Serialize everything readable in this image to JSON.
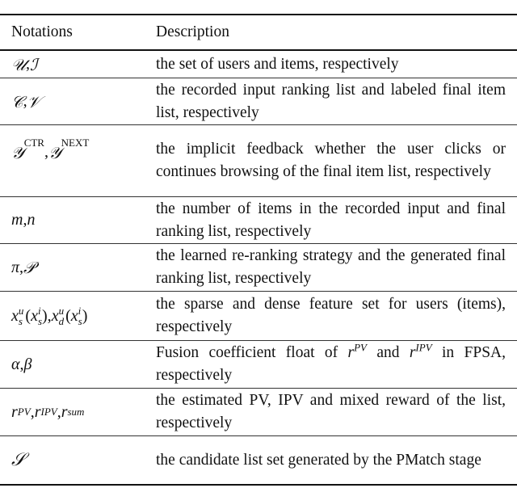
{
  "table": {
    "headers": {
      "notation": "Notations",
      "description": "Description"
    },
    "rows": [
      {
        "notation_parts": [
          "𝒰",
          ", ",
          "ℐ"
        ],
        "description": "the set of users and items, respectively"
      },
      {
        "notation_parts": [
          "𝒞",
          ", ",
          "𝒱"
        ],
        "description": "the recorded input ranking list and labeled final item list, respectively"
      },
      {
        "notation_parts": [
          "𝒴",
          "CTR",
          ", ",
          "𝒴",
          "NEXT"
        ],
        "description": "the implicit feedback whether the user clicks or continues browsing of the final item list, respectively"
      },
      {
        "notation_parts": [
          "m",
          ", ",
          "n"
        ],
        "description": "the number of items in the recorded input and final ranking list, respectively"
      },
      {
        "notation_parts": [
          "π",
          ", ",
          "𝒫"
        ],
        "description": "the learned re-ranking strategy and the generated final ranking list, respectively"
      },
      {
        "notation_parts": [
          "x",
          "u",
          "s",
          "(",
          "x",
          "i",
          "s",
          "), ",
          "x",
          "u",
          "d",
          "(",
          "x",
          "i",
          "s",
          ")"
        ],
        "description": "the sparse and dense feature set for users (items), respectively"
      },
      {
        "notation_parts": [
          "α",
          ", ",
          "β"
        ],
        "description_parts": [
          "Fusion coefficient float of ",
          "r",
          "PV",
          " and ",
          "r",
          "IPV",
          " in FPSA, respectively"
        ]
      },
      {
        "notation_parts": [
          "r",
          "PV",
          ", ",
          "r",
          "IPV",
          ", ",
          "r",
          "sum"
        ],
        "description": "the estimated PV, IPV and mixed reward of the list, respectively"
      },
      {
        "notation_parts": [
          "𝒮"
        ],
        "description": "the candidate list set generated by the PMatch stage"
      }
    ]
  }
}
